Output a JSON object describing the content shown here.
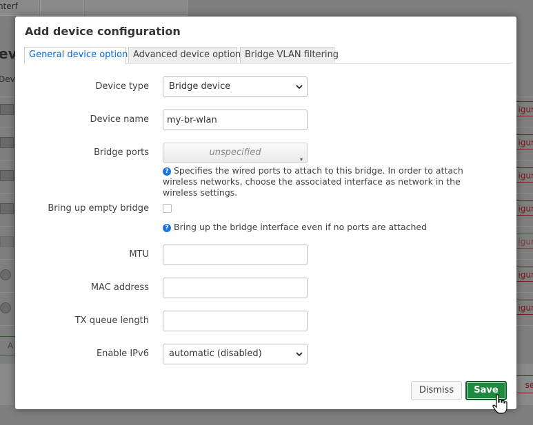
{
  "background": {
    "tabs": [
      "nterf"
    ],
    "title": "ev",
    "subtitle": "Dev",
    "row_button_label": "igure",
    "add_button_label": "A",
    "reset_button_label": "set"
  },
  "modal": {
    "title": "Add device configuration",
    "tabs": [
      {
        "label": "General device options",
        "active": true
      },
      {
        "label": "Advanced device options",
        "active": false
      },
      {
        "label": "Bridge VLAN filtering",
        "active": false
      }
    ],
    "fields": {
      "device_type": {
        "label": "Device type",
        "value": "Bridge device"
      },
      "device_name": {
        "label": "Device name",
        "value": "my-br-wlan"
      },
      "bridge_ports": {
        "label": "Bridge ports",
        "value": "unspecified",
        "help": "Specifies the wired ports to attach to this bridge. In order to attach wireless networks, choose the associated interface as network in the wireless settings."
      },
      "bring_up_empty": {
        "label": "Bring up empty bridge",
        "checked": false,
        "help": "Bring up the bridge interface even if no ports are attached"
      },
      "mtu": {
        "label": "MTU",
        "value": ""
      },
      "mac_address": {
        "label": "MAC address",
        "value": ""
      },
      "tx_queue_length": {
        "label": "TX queue length",
        "value": ""
      },
      "enable_ipv6": {
        "label": "Enable IPv6",
        "value": "automatic (disabled)"
      }
    },
    "buttons": {
      "dismiss": "Dismiss",
      "save": "Save"
    }
  },
  "colors": {
    "accent": "#0069d6",
    "save_green": "#1e8a3e",
    "help_icon": "#1e75d6"
  },
  "icons": [
    "chevron-down-icon",
    "help-icon",
    "hand-cursor-icon"
  ]
}
